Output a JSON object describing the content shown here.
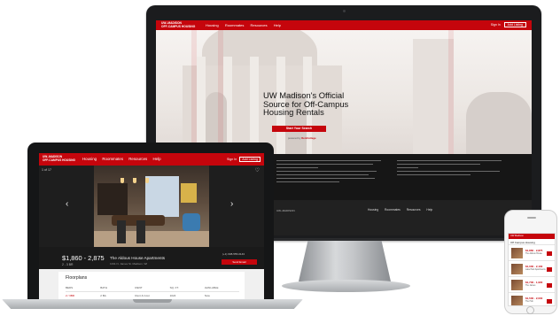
{
  "desktop": {
    "brand": [
      "UW–MADISON",
      "OFF-CAMPUS HOUSING"
    ],
    "nav": [
      "Housing",
      "Roommates",
      "Resources",
      "Help"
    ],
    "account": "Sign In",
    "add_listing": "Add Listing",
    "headline": "UW Madison's Official Source for Off-Campus Housing Rentals",
    "cta": "Start Your Search",
    "powered_by": [
      "powered by",
      "RentCollege"
    ]
  },
  "laptop": {
    "brand": [
      "UW–MADISON",
      "OFF-CAMPUS HOUSING"
    ],
    "nav": [
      "Housing",
      "Roommates",
      "Resources",
      "Help"
    ],
    "account": "Sign In",
    "add_listing": "Add Listing",
    "photo_counter": "1 of 17",
    "price": "$1,860 - 2,875",
    "beds": "2 - 3 BR",
    "apartment_name": "The Aldous House Apartments",
    "address": "1331 N. James St. Madison, WI",
    "phone": "(+1) 608-555-0143",
    "contact_button": "Send Email",
    "floorplans": {
      "title": "Floorplans",
      "headers": [
        "BEDS",
        "BATH",
        "RENT",
        "SQ. FT.",
        "AVAILABLE"
      ],
      "rows": [
        [
          "2 / 3BR",
          "2 BA",
          "Rent & Cost",
          "1024",
          "Now"
        ]
      ]
    }
  },
  "phone": {
    "brand": "UW Madison",
    "heading": "Off Campus Housing",
    "listings": [
      {
        "price": "$1,860 - 2,875",
        "name": "The Aldous House"
      },
      {
        "price": "$1,000 - 2,100",
        "name": "Lake Park Apartments"
      },
      {
        "price": "$1,700 - 1,900",
        "name": "The James"
      },
      {
        "price": "$1,500 - 2,000",
        "name": "The Hub"
      }
    ]
  },
  "colors": {
    "brand_red": "#c5050c",
    "dark": "#1a1a1a"
  },
  "icons": [
    "heart-icon",
    "prev-arrow-icon",
    "next-arrow-icon"
  ]
}
